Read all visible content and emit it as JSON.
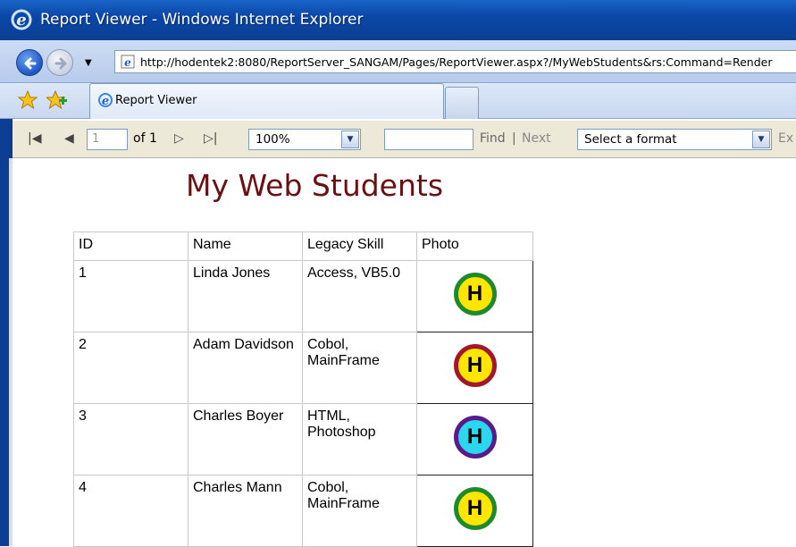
{
  "window": {
    "title": "Report Viewer - Windows Internet Explorer"
  },
  "address": {
    "url": "http://hodentek2:8080/ReportServer_SANGAM/Pages/ReportViewer.aspx?/MyWebStudents&rs:Command=Render"
  },
  "tabs": [
    {
      "label": "Report Viewer"
    }
  ],
  "toolbar": {
    "page_current": "1",
    "page_of": "of 1",
    "zoom": "100%",
    "find_label": "Find",
    "separator": "|",
    "next_label": "Next",
    "format_placeholder": "Select a format",
    "export_label": "Ex"
  },
  "report": {
    "title": "My Web Students",
    "columns": [
      "ID",
      "Name",
      "Legacy Skill",
      "Photo"
    ],
    "rows": [
      {
        "id": "1",
        "name": "Linda Jones",
        "skill": "Access, VB5.0",
        "photo": {
          "icon": "h-badge-icon",
          "fill": "#ffe600",
          "ring": "#1f8a2c"
        }
      },
      {
        "id": "2",
        "name": "Adam Davidson",
        "skill": "Cobol, MainFrame",
        "photo": {
          "icon": "h-badge-icon",
          "fill": "#ffe600",
          "ring": "#a3162b"
        }
      },
      {
        "id": "3",
        "name": "Charles Boyer",
        "skill": "HTML, Photoshop",
        "photo": {
          "icon": "h-badge-icon",
          "fill": "#2ad7ee",
          "ring": "#5a1a8a"
        }
      },
      {
        "id": "4",
        "name": "Charles Mann",
        "skill": "Cobol, MainFrame",
        "photo": {
          "icon": "h-badge-icon",
          "fill": "#ffe600",
          "ring": "#1f8a2c"
        }
      }
    ],
    "title_color": "#6b0f12"
  },
  "colors": {
    "titlebar": "#0a47a8",
    "toolbar_bg": "#ece9d8"
  }
}
